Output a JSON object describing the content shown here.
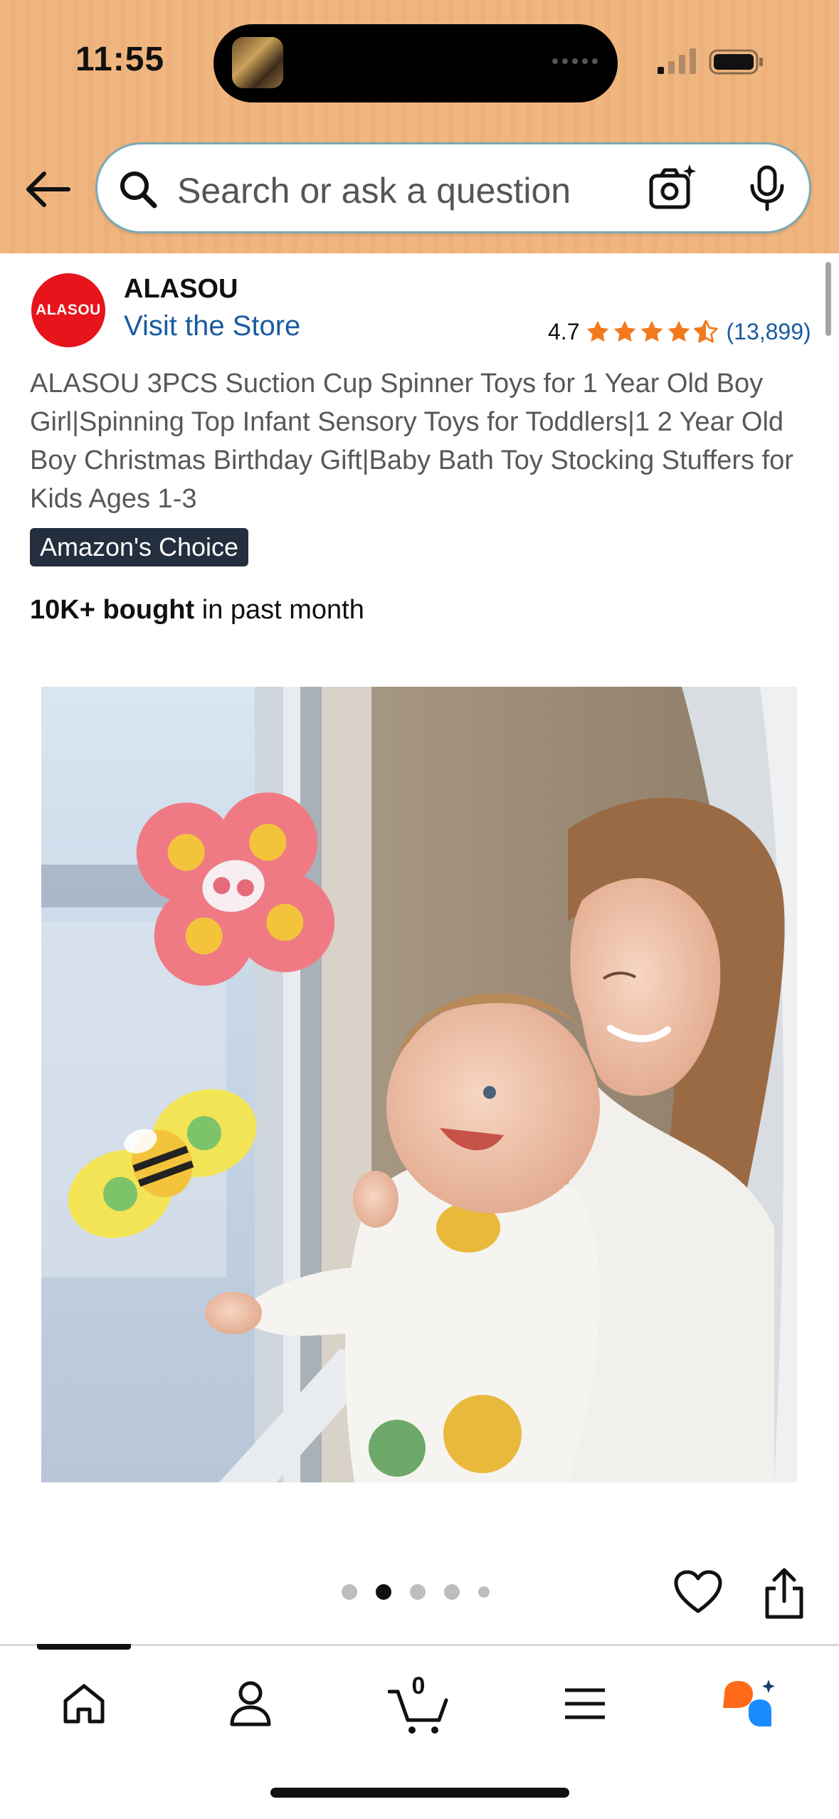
{
  "status_bar": {
    "time": "11:55"
  },
  "search": {
    "placeholder": "Search or ask a question"
  },
  "brand": {
    "logo_text": "ALASOU",
    "name": "ALASOU",
    "visit_store": "Visit the Store",
    "rating": "4.7",
    "rating_value": 4.7,
    "review_count": "(13,899)",
    "star_color": "#f3791d"
  },
  "product": {
    "title": "ALASOU 3PCS Suction Cup Spinner Toys for 1 Year Old Boy Girl|Spinning Top Infant Sensory Toys for Toddlers|1 2 Year Old Boy Christmas Birthday Gift|Baby Bath Toy Stocking Stuffers for Kids Ages 1-3",
    "badge": "Amazon's Choice",
    "bought_bold": "10K+ bought",
    "bought_rest": " in past month"
  },
  "carousel": {
    "total": 5,
    "active_index": 1
  },
  "bottom_nav": {
    "items": [
      "home-icon",
      "account-icon",
      "cart-icon",
      "menu-icon",
      "rufus-icon"
    ],
    "cart_count": "0",
    "active": "home"
  },
  "colors": {
    "header_bg": "#f0b67f",
    "link": "#1a5ba1",
    "badge_bg": "#232f3e",
    "logo_red": "#e7141c",
    "rufus_orange": "#ff6a1a",
    "rufus_blue": "#1a8cff"
  }
}
